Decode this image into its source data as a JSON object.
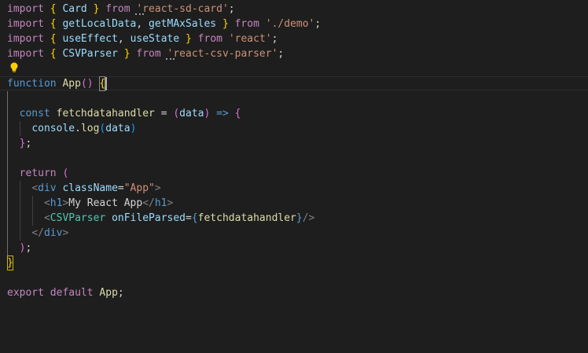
{
  "colors": {
    "background": "#1e1e1e",
    "keyword_control": "#c586c0",
    "keyword": "#569cd6",
    "variable": "#9cdcfe",
    "function": "#dcdcaa",
    "string": "#ce9178",
    "component": "#4ec9b0",
    "tag_bracket": "#808080",
    "default": "#d4d4d4",
    "bracket_gold": "#ffd700",
    "bracket_purple": "#da70d6",
    "bracket_blue": "#179fff"
  },
  "icons": {
    "lightbulb": "lightbulb-icon"
  },
  "code": {
    "l1": {
      "k": "import",
      "b1": "{",
      "v": "Card",
      "b2": "}",
      "from": "from",
      "q": "'",
      "s": "react-sd-card'",
      "semi": ";"
    },
    "l2": {
      "k": "import",
      "b1": "{",
      "v1": "getLocalData",
      "comma": ",",
      "v2": "getMAxSales",
      "b2": "}",
      "from": "from",
      "s": "'./demo'",
      "semi": ";"
    },
    "l3": {
      "k": "import",
      "b1": "{",
      "v1": "useEffect",
      "comma": ",",
      "v2": "useState",
      "b2": "}",
      "from": "from",
      "s": "'react'",
      "semi": ";"
    },
    "l4": {
      "k": "import",
      "b1": "{",
      "v": "CSVParser",
      "b2": "}",
      "from": "from",
      "q": "'",
      "s": "react-csv-parser'",
      "semi": ";"
    },
    "l6": {
      "k": "function",
      "fn": "App",
      "p1": "(",
      "p2": ")",
      "b": "{"
    },
    "l8": {
      "k": "const",
      "fn": "fetchdatahandler",
      "eq": "=",
      "p1": "(",
      "param": "data",
      "p2": ")",
      "arrow": "=>",
      "b": "{"
    },
    "l9": {
      "obj": "console",
      "dot": ".",
      "fn": "log",
      "p1": "(",
      "arg": "data",
      "p2": ")"
    },
    "l10": {
      "b": "}",
      "semi": ";"
    },
    "l12": {
      "k": "return",
      "p": "("
    },
    "l13": {
      "lt": "<",
      "tag": "div",
      "attr": "className",
      "eq": "=",
      "val": "\"App\"",
      "gt": ">"
    },
    "l14": {
      "lt": "<",
      "tag": "h1",
      "gt": ">",
      "text": "My React App",
      "lt2": "</",
      "tag2": "h1",
      "gt2": ">"
    },
    "l15": {
      "lt": "<",
      "tag": "CSVParser",
      "attr": "onFileParsed",
      "eq": "=",
      "b1": "{",
      "val": "fetchdatahandler",
      "b2": "}",
      "end": "/>"
    },
    "l16": {
      "lt": "</",
      "tag": "div",
      "gt": ">"
    },
    "l17": {
      "p": ")",
      "semi": ";"
    },
    "l18": {
      "b": "}"
    },
    "l20": {
      "k1": "export",
      "k2": "default",
      "v": "App",
      "semi": ";"
    }
  }
}
